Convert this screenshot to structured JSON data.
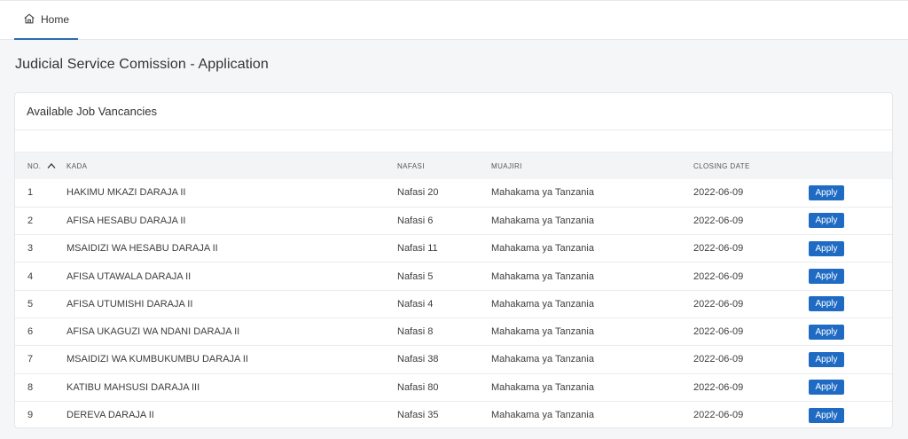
{
  "nav": {
    "home_label": "Home"
  },
  "page": {
    "title": "Judicial Service Comission - Application"
  },
  "card": {
    "title": "Available Job Vancancies"
  },
  "table": {
    "headers": [
      "NO.",
      "KADA",
      "NAFASI",
      "MUAJIRI",
      "CLOSING DATE",
      ""
    ],
    "rows": [
      {
        "no": "1",
        "kada": "HAKIMU MKAZI DARAJA II",
        "nafasi": "Nafasi 20",
        "muajiri": "Mahakama ya Tanzania",
        "closing": "2022-06-09",
        "action": "Apply"
      },
      {
        "no": "2",
        "kada": "AFISA HESABU DARAJA II",
        "nafasi": "Nafasi 6",
        "muajiri": "Mahakama ya Tanzania",
        "closing": "2022-06-09",
        "action": "Apply"
      },
      {
        "no": "3",
        "kada": "MSAIDIZI WA HESABU DARAJA II",
        "nafasi": "Nafasi 11",
        "muajiri": "Mahakama ya Tanzania",
        "closing": "2022-06-09",
        "action": "Apply"
      },
      {
        "no": "4",
        "kada": "AFISA UTAWALA DARAJA II",
        "nafasi": "Nafasi 5",
        "muajiri": "Mahakama ya Tanzania",
        "closing": "2022-06-09",
        "action": "Apply"
      },
      {
        "no": "5",
        "kada": "AFISA UTUMISHI DARAJA II",
        "nafasi": "Nafasi 4",
        "muajiri": "Mahakama ya Tanzania",
        "closing": "2022-06-09",
        "action": "Apply"
      },
      {
        "no": "6",
        "kada": "AFISA UKAGUZI WA NDANI DARAJA II",
        "nafasi": "Nafasi 8",
        "muajiri": "Mahakama ya Tanzania",
        "closing": "2022-06-09",
        "action": "Apply"
      },
      {
        "no": "7",
        "kada": "MSAIDIZI WA KUMBUKUMBU DARAJA II",
        "nafasi": "Nafasi 38",
        "muajiri": "Mahakama ya Tanzania",
        "closing": "2022-06-09",
        "action": "Apply"
      },
      {
        "no": "8",
        "kada": "KATIBU MAHSUSI DARAJA III",
        "nafasi": "Nafasi 80",
        "muajiri": "Mahakama ya Tanzania",
        "closing": "2022-06-09",
        "action": "Apply"
      },
      {
        "no": "9",
        "kada": "DEREVA DARAJA II",
        "nafasi": "Nafasi 35",
        "muajiri": "Mahakama ya Tanzania",
        "closing": "2022-06-09",
        "action": "Apply"
      }
    ]
  },
  "icons": {
    "home": "home-icon",
    "sort": "chevron-up-icon"
  },
  "colors": {
    "accent": "#1f6bc4",
    "background": "#f5f6f8",
    "header_row": "#f3f4f6"
  }
}
